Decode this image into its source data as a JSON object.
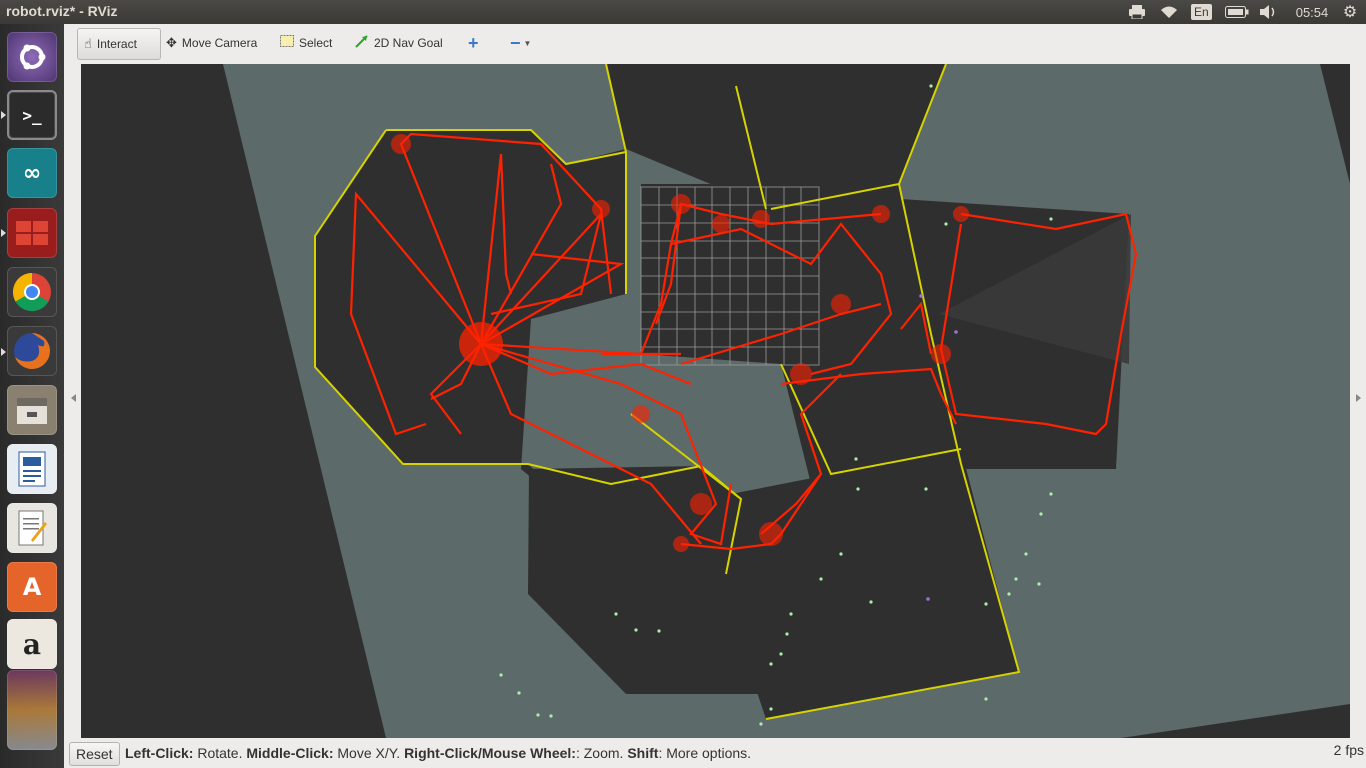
{
  "window": {
    "title": "robot.rviz* - RViz"
  },
  "tray": {
    "lang": "En",
    "time": "05:54"
  },
  "launcher": [
    {
      "name": "ubuntu-home-icon"
    },
    {
      "name": "terminal-icon"
    },
    {
      "name": "arduino-icon"
    },
    {
      "name": "workspace-icon"
    },
    {
      "name": "chrome-icon"
    },
    {
      "name": "firefox-icon"
    },
    {
      "name": "files-icon"
    },
    {
      "name": "writer-icon"
    },
    {
      "name": "text-editor-icon"
    },
    {
      "name": "software-center-icon"
    },
    {
      "name": "amazon-icon"
    },
    {
      "name": "app-stack-icon"
    }
  ],
  "toolbar": {
    "interact": "Interact",
    "move_camera": "Move Camera",
    "select": "Select",
    "nav_goal": "2D Nav Goal"
  },
  "status": {
    "reset": "Reset",
    "left_click": "Left-Click:",
    "left_click_desc": " Rotate. ",
    "middle_click": "Middle-Click:",
    "middle_click_desc": " Move X/Y. ",
    "right_click": "Right-Click/Mouse Wheel:",
    "right_click_desc": ": Zoom. ",
    "shift": "Shift",
    "shift_desc": ": More options.",
    "fps": "2 fps"
  },
  "colors": {
    "map_unknown": "#5d6a6a",
    "map_free": "#2f2f2f",
    "map_wall": "#d6d300",
    "tree": "#ff2200",
    "grid": "#9a9a9a"
  }
}
